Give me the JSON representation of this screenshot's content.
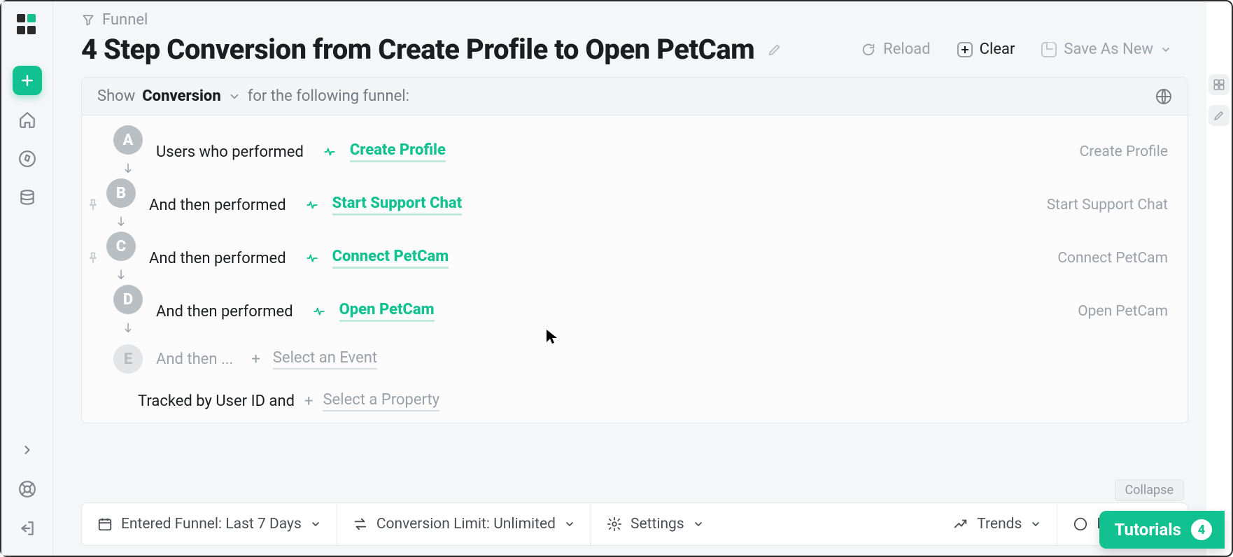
{
  "crumb": {
    "label": "Funnel"
  },
  "title": "4 Step Conversion from Create Profile to Open PetCam",
  "header_buttons": {
    "reload": "Reload",
    "clear": "Clear",
    "save_as_new": "Save As New"
  },
  "query_head": {
    "show": "Show",
    "metric": "Conversion",
    "suffix": "for the following funnel:"
  },
  "steps": [
    {
      "letter": "A",
      "lead": "Users who performed",
      "event": "Create Profile",
      "rlabel": "Create Profile",
      "pinned": false,
      "arrow": true
    },
    {
      "letter": "B",
      "lead": "And then performed",
      "event": "Start Support Chat",
      "rlabel": "Start Support Chat",
      "pinned": true,
      "arrow": true
    },
    {
      "letter": "C",
      "lead": "And then performed",
      "event": "Connect PetCam",
      "rlabel": "Connect PetCam",
      "pinned": true,
      "arrow": true
    },
    {
      "letter": "D",
      "lead": "And then performed",
      "event": "Open PetCam",
      "rlabel": "Open PetCam",
      "pinned": false,
      "arrow": true
    }
  ],
  "placeholder_step": {
    "letter": "E",
    "lead": "And then ...",
    "select": "Select an Event"
  },
  "tracked": {
    "prefix": "Tracked by User ID and",
    "select": "Select a Property"
  },
  "collapse": "Collapse",
  "bottom": {
    "date": "Entered Funnel: Last 7 Days",
    "limit": "Conversion Limit: Unlimited",
    "settings": "Settings",
    "trends": "Trends",
    "multipath": "Multipath D"
  },
  "tutorials": {
    "label": "Tutorials",
    "count": "4"
  }
}
